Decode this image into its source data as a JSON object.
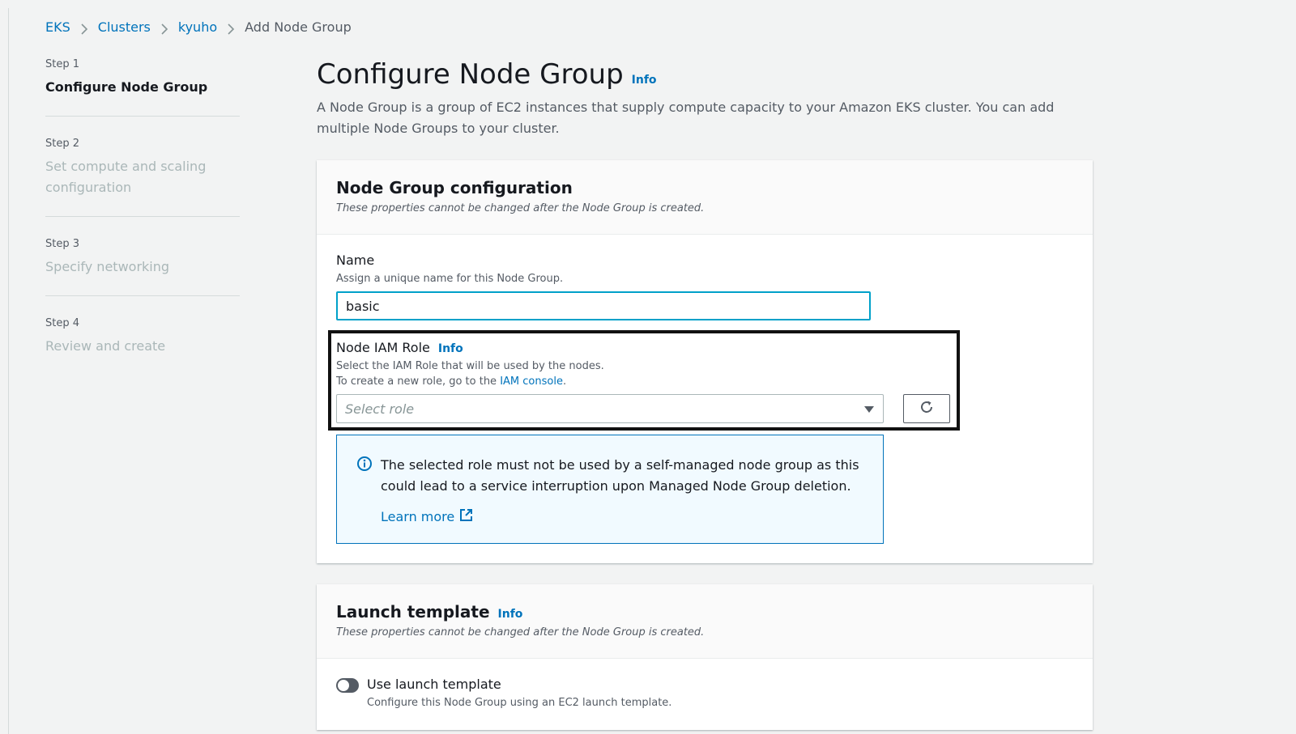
{
  "breadcrumb": {
    "items": [
      "EKS",
      "Clusters",
      "kyuho"
    ],
    "current": "Add Node Group"
  },
  "steps": [
    {
      "num": "Step 1",
      "title": "Configure Node Group",
      "active": true
    },
    {
      "num": "Step 2",
      "title": "Set compute and scaling configuration",
      "active": false
    },
    {
      "num": "Step 3",
      "title": "Specify networking",
      "active": false
    },
    {
      "num": "Step 4",
      "title": "Review and create",
      "active": false
    }
  ],
  "page": {
    "title": "Configure Node Group",
    "info": "Info",
    "description": "A Node Group is a group of EC2 instances that supply compute capacity to your Amazon EKS cluster. You can add multiple Node Groups to your cluster."
  },
  "node_group_panel": {
    "title": "Node Group configuration",
    "subtitle": "These properties cannot be changed after the Node Group is created.",
    "name_label": "Name",
    "name_desc": "Assign a unique name for this Node Group.",
    "name_value": "basic",
    "iam_label": "Node IAM Role",
    "iam_info": "Info",
    "iam_desc_1": "Select the IAM Role that will be used by the nodes.",
    "iam_desc_2_prefix": "To create a new role, go to the ",
    "iam_desc_2_link": "IAM console",
    "iam_desc_2_suffix": ".",
    "select_placeholder": "Select role",
    "alert_text": "The selected role must not be used by a self-managed node group as this could lead to a service interruption upon Managed Node Group deletion.",
    "alert_link": "Learn more"
  },
  "launch_panel": {
    "title": "Launch template",
    "info": "Info",
    "subtitle": "These properties cannot be changed after the Node Group is created.",
    "toggle_label": "Use launch template",
    "toggle_desc": "Configure this Node Group using an EC2 launch template."
  },
  "colors": {
    "link": "#0073bb",
    "focus": "#00a1c9",
    "background": "#f2f3f3"
  }
}
